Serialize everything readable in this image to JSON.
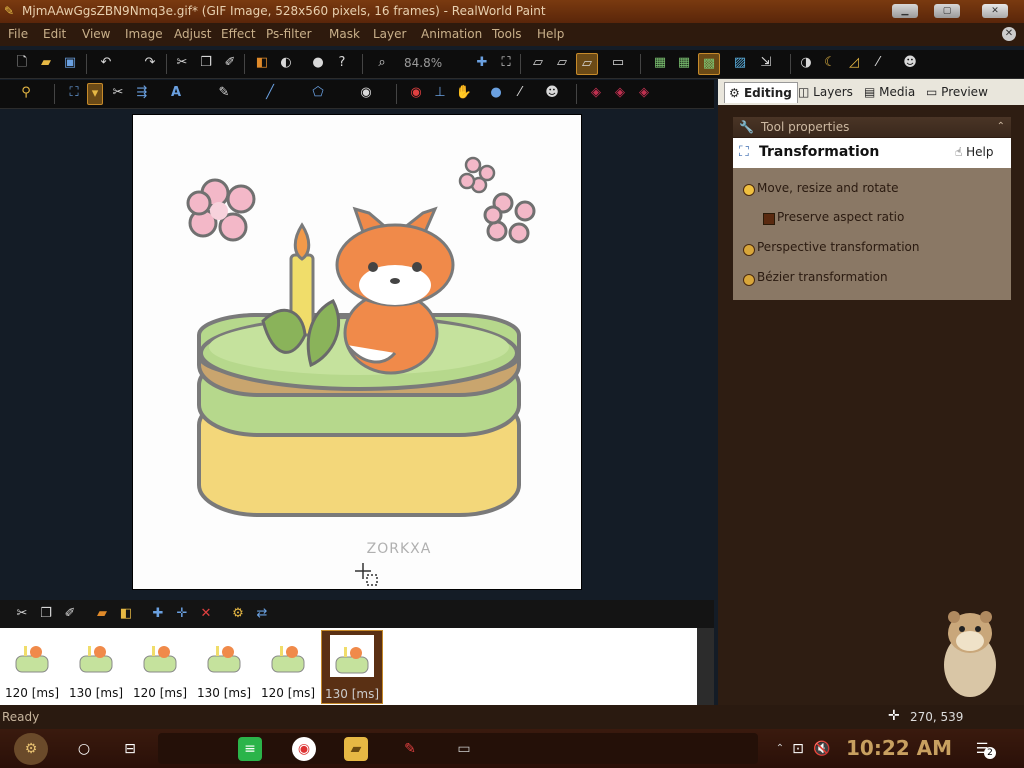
{
  "window": {
    "title": "MjmAAwGgsZBN9Nmq3e.gif* (GIF Image, 528x560 pixels, 16 frames) - RealWorld Paint"
  },
  "menu": [
    "File",
    "Edit",
    "View",
    "Image",
    "Adjust",
    "Effect",
    "Ps-filter",
    "Mask",
    "Layer",
    "Animation",
    "Tools",
    "Help"
  ],
  "toolbar": {
    "zoom": "84.8%"
  },
  "canvas": {
    "watermark": "ZORKXA"
  },
  "panel": {
    "tabs": [
      "Editing",
      "Layers",
      "Media",
      "Preview"
    ],
    "active_tab": "Editing",
    "tool_properties_header": "Tool properties",
    "tool_title": "Transformation",
    "help_label": "Help",
    "options": {
      "move_resize_rotate": "Move, resize and rotate",
      "preserve_aspect": "Preserve aspect ratio",
      "perspective": "Perspective transformation",
      "bezier": "Bézier transformation"
    }
  },
  "frames": [
    {
      "label": "120 [ms]"
    },
    {
      "label": "130 [ms]"
    },
    {
      "label": "120 [ms]"
    },
    {
      "label": "130 [ms]"
    },
    {
      "label": "120 [ms]"
    },
    {
      "label": "130 [ms]",
      "selected": true
    }
  ],
  "status": {
    "text": "Ready",
    "coords": "270, 539"
  },
  "taskbar": {
    "time": "10:22 AM",
    "notifications": "2"
  },
  "colors": {
    "accent": "#c68a2a",
    "titlebar": "#7a3a10",
    "panel_bg": "#2e1d12"
  }
}
